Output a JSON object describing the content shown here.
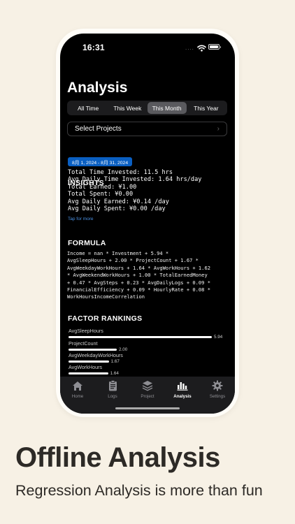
{
  "status": {
    "time": "16:31",
    "dots": "...."
  },
  "page": {
    "title": "Analysis"
  },
  "segments": [
    {
      "label": "All Time",
      "active": false
    },
    {
      "label": "This Week",
      "active": false
    },
    {
      "label": "This Month",
      "active": true
    },
    {
      "label": "This Year",
      "active": false
    }
  ],
  "project_select": {
    "label": "Select Projects"
  },
  "insights": {
    "heading": "INSIGHTS",
    "date_range": "8月 1, 2024 - 8月 31, 2024",
    "lines": [
      "Total Time Invested: 11.5 hrs",
      "Avg Daily Time Invested: 1.64 hrs/day",
      "Total Earned: ¥1.00",
      "Total Spent: ¥0.00",
      "Avg Daily Earned: ¥0.14 /day",
      "Avg Daily Spent: ¥0.00 /day"
    ],
    "tap_more": "Tap for more"
  },
  "formula": {
    "heading": "FORMULA",
    "text": "Income = nan * Investment + 5.94 *\nAvgSleepHours + 2.00 * ProjectCount + 1.67 *\nAvgWeekdayWorkHours + 1.64 * AvgWorkHours + 1.62\n* AvgWeekendWorkHours + 1.00 * TotalEarnedMoney\n+ 0.47 * AvgSteps + 0.23 * AvgDailyLogs + 0.09 *\nFinancialEfficiency + 0.09 * HourlyRate + 0.08 *\nWorkHoursIncomeCorrelation"
  },
  "rankings": {
    "heading": "FACTOR RANKINGS",
    "max": 5.94,
    "items": [
      {
        "name": "AvgSleepHours",
        "value": 5.94,
        "label": "5.94"
      },
      {
        "name": "ProjectCount",
        "value": 2.0,
        "label": "2.00"
      },
      {
        "name": "AvgWeekdayWorkHours",
        "value": 1.67,
        "label": "1.67"
      },
      {
        "name": "AvgWorkHours",
        "value": 1.64,
        "label": "1.64"
      }
    ]
  },
  "tabs": [
    {
      "label": "Home",
      "icon": "house-icon",
      "active": false
    },
    {
      "label": "Logs",
      "icon": "clipboard-icon",
      "active": false
    },
    {
      "label": "Project",
      "icon": "layers-icon",
      "active": false
    },
    {
      "label": "Analysis",
      "icon": "chart-bars-icon",
      "active": true
    },
    {
      "label": "Settings",
      "icon": "gear-icon",
      "active": false
    }
  ],
  "marketing": {
    "headline": "Offline Analysis",
    "subline": "Regression Analysis is more than fun"
  }
}
